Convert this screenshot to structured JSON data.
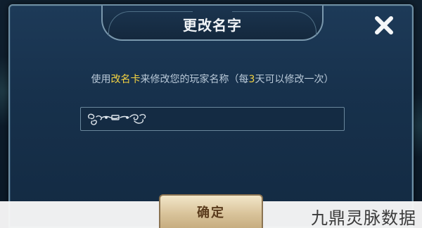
{
  "dialog": {
    "title": "更改名字",
    "close_icon": "close-icon",
    "instruction": {
      "prefix": "使用",
      "card_name": "改名卡",
      "middle": "来修改您的玩家名称（每",
      "days": "3",
      "suffix": "天可以修改一次）"
    },
    "name_input": {
      "ornament_icon": "name-ornament-icon",
      "value": ""
    },
    "confirm_label": "确定"
  },
  "watermark": "九鼎灵脉数据",
  "colors": {
    "highlight": "#f5d442",
    "panel": "#17314c",
    "confirm_text": "#5a3b1c"
  }
}
